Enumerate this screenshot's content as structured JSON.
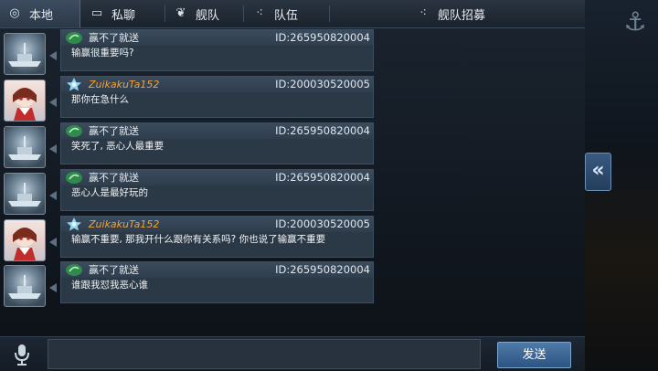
{
  "tabs": [
    {
      "label": "本地",
      "icon": "globe-icon"
    },
    {
      "label": "私聊",
      "icon": "message-icon"
    },
    {
      "label": "舰队",
      "icon": "fleet-icon"
    },
    {
      "label": "队伍",
      "icon": "team-icon"
    },
    {
      "label": "舰队招募",
      "icon": "recruit-icon"
    }
  ],
  "messages": [
    {
      "user": "赢不了就送",
      "id": "ID:265950820004",
      "text": "输赢很重要吗?",
      "avatar": "warship-avatar",
      "badge": "green-rank-badge"
    },
    {
      "user": "ZuikakuTa152",
      "id": "ID:200030520005",
      "text": "那你在急什么",
      "avatar": "anime-girl-avatar",
      "badge": "blue-star-badge"
    },
    {
      "user": "赢不了就送",
      "id": "ID:265950820004",
      "text": "笑死了, 恶心人最重要",
      "avatar": "warship-avatar",
      "badge": "green-rank-badge"
    },
    {
      "user": "赢不了就送",
      "id": "ID:265950820004",
      "text": "恶心人是最好玩的",
      "avatar": "warship-avatar",
      "badge": "green-rank-badge"
    },
    {
      "user": "ZuikakuTa152",
      "id": "ID:200030520005",
      "text": " 输赢不重要, 那我开什么跟你有关系吗? 你也说了输赢不重要",
      "avatar": "anime-girl-avatar",
      "badge": "blue-star-badge"
    },
    {
      "user": "赢不了就送",
      "id": "ID:265950820004",
      "text": "谁跟我怼我恶心谁",
      "avatar": "warship-avatar",
      "badge": "green-rank-badge"
    }
  ],
  "input": {
    "value": "",
    "placeholder": ""
  },
  "send_label": "发送",
  "colors": {
    "accent_blue": "#4f7aa8",
    "username_orange": "#f0a23a",
    "panel_bg": "#2b3947"
  }
}
